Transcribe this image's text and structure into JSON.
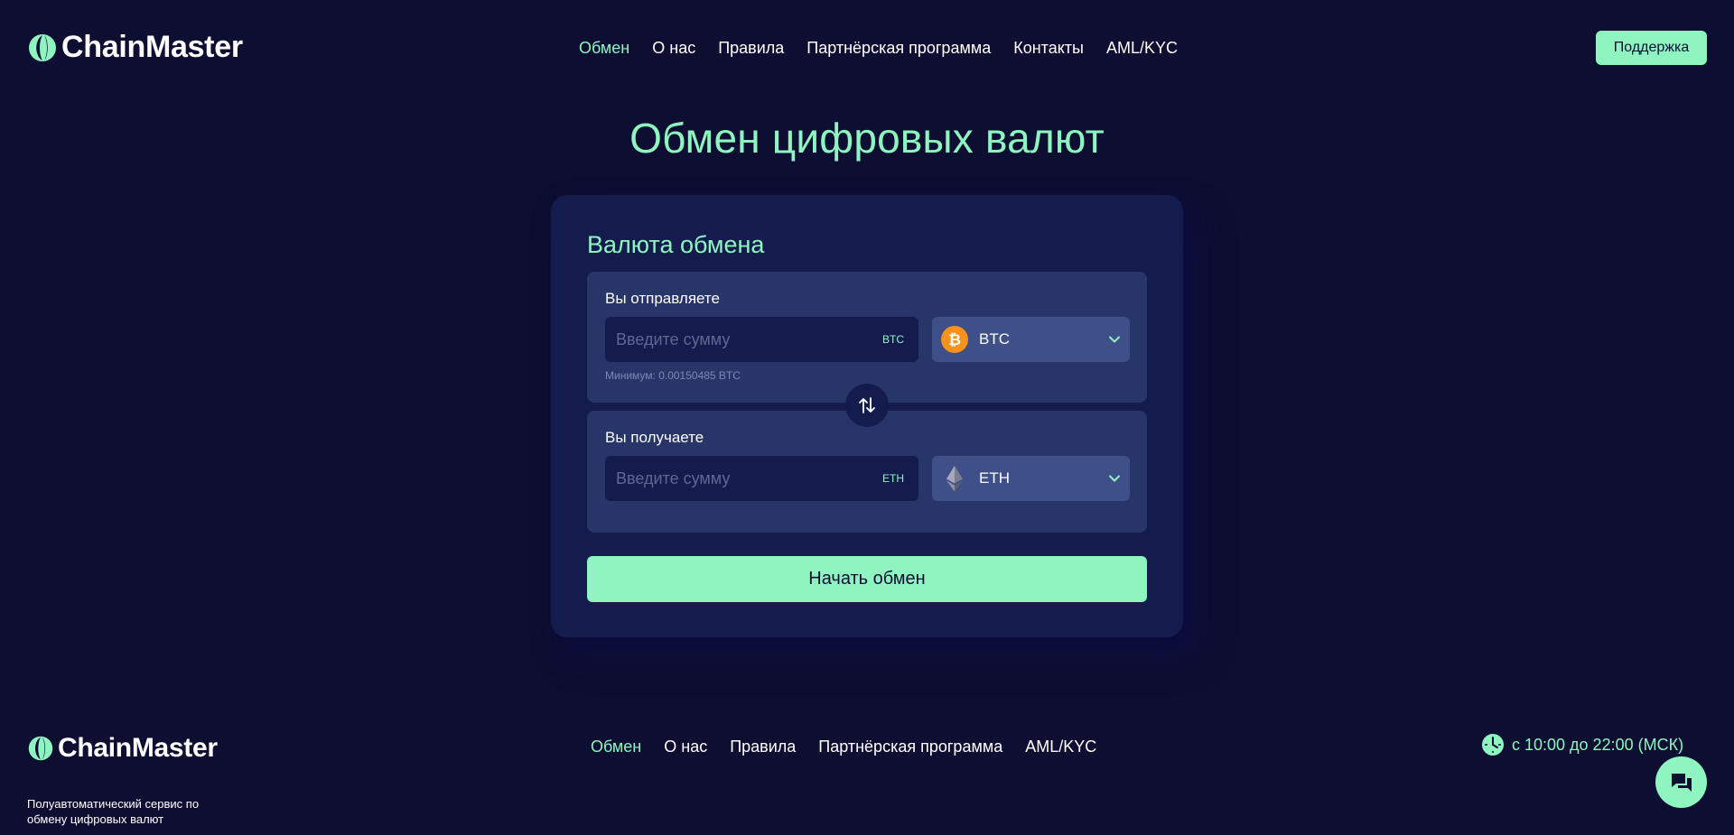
{
  "brand": {
    "name": "ChainMaster",
    "accent_color": "#8ef5c0",
    "background_color": "#0d0e31"
  },
  "header": {
    "nav": [
      {
        "label": "Обмен",
        "active": true
      },
      {
        "label": "О нас",
        "active": false
      },
      {
        "label": "Правила",
        "active": false
      },
      {
        "label": "Партнёрская программа",
        "active": false
      },
      {
        "label": "Контакты",
        "active": false
      },
      {
        "label": "AML/KYC",
        "active": false
      }
    ],
    "support_label": "Поддержка"
  },
  "page_title": "Обмен цифровых валют",
  "exchange": {
    "title": "Валюта обмена",
    "send": {
      "label": "Вы отправляете",
      "placeholder": "Введите сумму",
      "unit": "BTC",
      "min_note": "Минимум: 0.00150485 BTC",
      "currency": "BTC",
      "icon": "bitcoin-icon"
    },
    "receive": {
      "label": "Вы получаете",
      "placeholder": "Введите сумму",
      "unit": "ETH",
      "currency": "ETH",
      "icon": "ethereum-icon"
    },
    "swap_icon": "swap-arrows-icon",
    "start_label": "Начать обмен"
  },
  "footer": {
    "nav": [
      {
        "label": "Обмен",
        "active": true
      },
      {
        "label": "О нас",
        "active": false
      },
      {
        "label": "Правила",
        "active": false
      },
      {
        "label": "Партнёрская программа",
        "active": false
      },
      {
        "label": "AML/KYC",
        "active": false
      }
    ],
    "tagline": "Полуавтоматический сервис по обмену цифровых валют",
    "hours": "с 10:00 до 22:00 (МСК)",
    "hours_icon": "clock-icon",
    "chat_icon": "chat-icon"
  }
}
